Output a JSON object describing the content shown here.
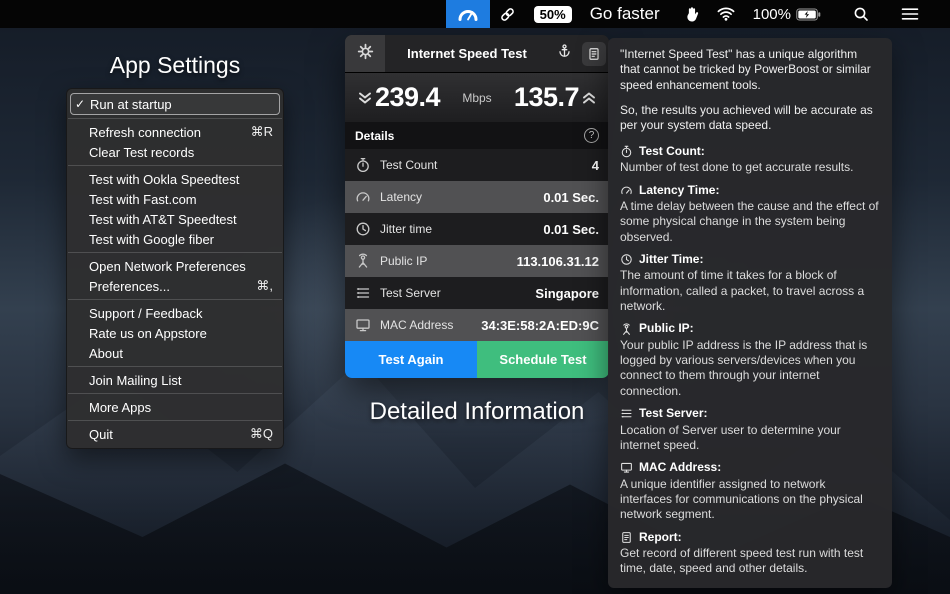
{
  "menubar": {
    "boost_badge": "50%",
    "go_faster_label": "Go faster",
    "battery_percent": "100%"
  },
  "app_settings": {
    "title": "App Settings",
    "check_glyph": "✓",
    "groups": [
      [
        {
          "label": "Run at startup",
          "checked": true,
          "highlighted": true
        }
      ],
      [
        {
          "label": "Refresh connection",
          "shortcut": "⌘R"
        },
        {
          "label": "Clear Test records"
        }
      ],
      [
        {
          "label": "Test with Ookla Speedtest"
        },
        {
          "label": "Test with Fast.com"
        },
        {
          "label": "Test with AT&T Speedtest"
        },
        {
          "label": "Test with Google fiber"
        }
      ],
      [
        {
          "label": "Open Network Preferences"
        },
        {
          "label": "Preferences...",
          "shortcut": "⌘,"
        }
      ],
      [
        {
          "label": "Support / Feedback"
        },
        {
          "label": "Rate us on Appstore"
        },
        {
          "label": "About"
        }
      ],
      [
        {
          "label": "Join Mailing List"
        }
      ],
      [
        {
          "label": "More Apps"
        }
      ],
      [
        {
          "label": "Quit",
          "shortcut": "⌘Q"
        }
      ]
    ]
  },
  "speed_panel": {
    "title": "Internet Speed Test",
    "download": "239.4",
    "unit": "Mbps",
    "upload": "135.7",
    "details_header": "Details",
    "help_glyph": "?",
    "rows": [
      {
        "icon": "stopwatch-icon",
        "label": "Test Count",
        "value": "4"
      },
      {
        "icon": "gauge-icon",
        "label": "Latency",
        "value": "0.01 Sec."
      },
      {
        "icon": "clock-icon",
        "label": "Jitter time",
        "value": "0.01 Sec."
      },
      {
        "icon": "antenna-icon",
        "label": "Public IP",
        "value": "113.106.31.12"
      },
      {
        "icon": "server-icon",
        "label": "Test Server",
        "value": "Singapore"
      },
      {
        "icon": "monitor-icon",
        "label": "MAC Address",
        "value": "34:3E:58:2A:ED:9C"
      }
    ],
    "test_again_label": "Test Again",
    "schedule_label": "Schedule Test"
  },
  "caption": "Detailed Information",
  "info_panel": {
    "intro": [
      "\"Internet Speed Test\" has a unique algorithm that cannot be tricked by PowerBoost or similar speed enhancement tools.",
      "So, the results you achieved will be accurate as per your system data speed."
    ],
    "sections": [
      {
        "icon": "stopwatch-icon",
        "title": "Test Count:",
        "body": "Number of test done to get accurate results."
      },
      {
        "icon": "gauge-icon",
        "title": "Latency Time:",
        "body": "A time delay between the cause and the effect of some physical change in the system being observed."
      },
      {
        "icon": "clock-icon",
        "title": "Jitter Time:",
        "body": "The amount of time it takes for a block of information, called a packet, to travel across a network."
      },
      {
        "icon": "antenna-icon",
        "title": "Public IP:",
        "body": "Your public IP address is the IP address that is logged by various servers/devices when you connect to them through your internet connection."
      },
      {
        "icon": "server-icon",
        "title": "Test Server:",
        "body": "Location of Server user to determine your internet speed."
      },
      {
        "icon": "monitor-icon",
        "title": "MAC Address:",
        "body": "A unique identifier assigned to network interfaces for communications on the physical network segment."
      },
      {
        "icon": "doc-icon",
        "title": "Report:",
        "body": "Get record of different speed test run with test time, date, speed and other details."
      }
    ]
  },
  "colors": {
    "accent_blue": "#1789f5",
    "accent_green": "#3fbe7e",
    "menubar_selection": "#1e7ce0"
  }
}
